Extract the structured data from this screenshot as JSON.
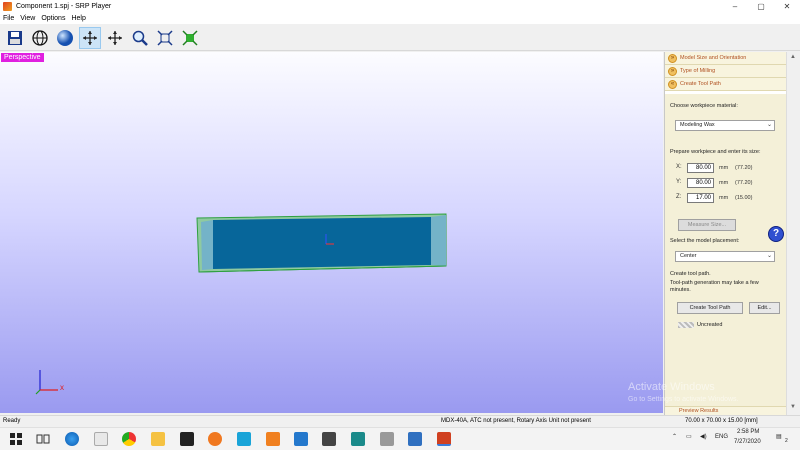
{
  "window": {
    "title": "Component 1.spj - SRP Player"
  },
  "menu": {
    "items": [
      "File",
      "View",
      "Options",
      "Help"
    ]
  },
  "toolbar": {
    "tools": [
      "save-icon",
      "globe-icon",
      "sphere-icon",
      "move-icon",
      "pan-icon",
      "zoom-icon",
      "fit-icon",
      "fit-all-icon"
    ]
  },
  "viewport": {
    "label": "Perspective",
    "axis_x": "x"
  },
  "panel": {
    "steps": [
      "Model Size and Orientation",
      "Type of Milling",
      "Create Tool Path"
    ],
    "material_label": "Choose workpiece material:",
    "material_value": "Modeling Wax",
    "size_label": "Prepare workpiece and enter its size:",
    "x_label": "X:",
    "x_value": "80.00",
    "x_hint": "(77.20)",
    "y_label": "Y:",
    "y_value": "80.00",
    "y_hint": "(77.20)",
    "z_label": "Z:",
    "z_value": "17.00",
    "z_hint": "(15.00)",
    "unit": "mm",
    "measure_button": "Measure Size...",
    "placement_label": "Select the model placement:",
    "placement_value": "Center",
    "create_label": "Create tool path.",
    "create_note": "Tool-path generation may take a few minutes.",
    "create_button": "Create Tool Path",
    "edit_button": "Edit...",
    "status": "Uncreated",
    "preview": "Preview Results",
    "help": "?"
  },
  "statusbar": {
    "left": "Ready",
    "middle": "MDX-40A, ATC not present, Rotary Axis Unit not present",
    "right": "70.00 x  70.00 x  15.00 [mm]"
  },
  "watermark": {
    "title": "Activate Windows",
    "sub": "Go to Settings to activate Windows."
  },
  "tray": {
    "lang": "ENG",
    "time": "2:58 PM",
    "date": "7/27/2020",
    "badge": "2"
  }
}
